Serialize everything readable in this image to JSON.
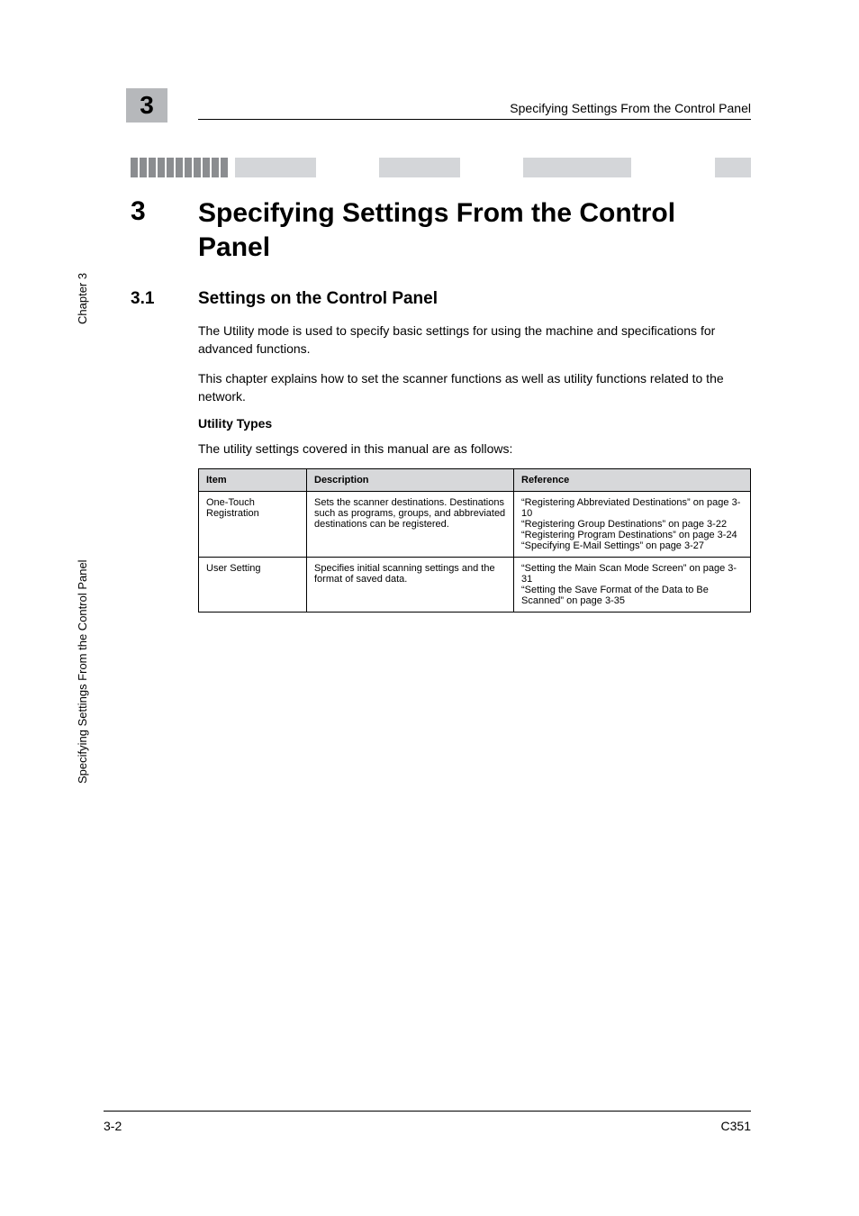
{
  "running_header": "Specifying Settings From the Control Panel",
  "chapter_badge": "3",
  "h1_num": "3",
  "h1_title": "Specifying Settings From the Control Panel",
  "h2_num": "3.1",
  "h2_title": "Settings on the Control Panel",
  "para1": "The Utility mode is used to specify basic settings for using the machine and specifications for advanced functions.",
  "para2": "This chapter explains how to set the scanner functions as well as utility functions related to the network.",
  "h3_a": "Utility Types",
  "para3": "The utility settings covered in this manual are as follows:",
  "table": {
    "headers": {
      "c1": "Item",
      "c2": "Description",
      "c3": "Reference"
    },
    "rows": [
      {
        "item": "One-Touch Registration",
        "desc": "Sets the scanner destinations. Destinations such as programs, groups, and abbreviated destinations can be registered.",
        "ref": "“Registering Abbreviated Destinations” on page 3-10\n“Registering Group Destinations” on page 3-22\n“Registering Program Destinations” on page 3-24\n“Specifying E-Mail Settings” on page 3-27"
      },
      {
        "item": "User Setting",
        "desc": "Specifies initial scanning settings and the format of saved data.",
        "ref": "“Setting the Main Scan Mode Screen” on page 3-31\n“Setting the Save Format of the Data to Be Scanned” on page 3-35"
      }
    ]
  },
  "sidebar_upper": "Chapter 3",
  "sidebar_lower": "Specifying Settings From the Control Panel",
  "footer_left": "3-2",
  "footer_right": "C351"
}
